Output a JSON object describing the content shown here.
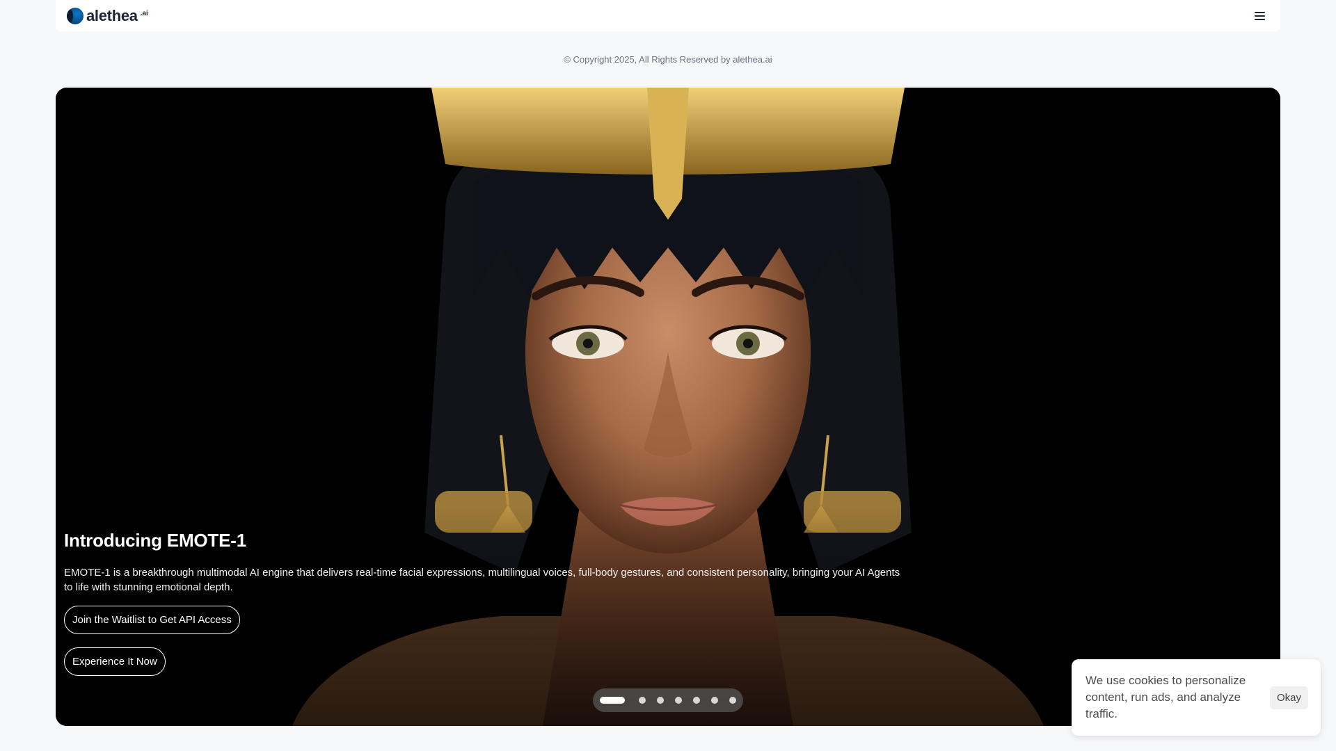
{
  "header": {
    "logo_text": "alethea",
    "logo_suffix": ".ai",
    "menu_icon": "hamburger-menu-icon"
  },
  "footer": {
    "copyright": "© Copyright 2025, All Rights Reserved by alethea.ai"
  },
  "hero": {
    "title": "Introducing EMOTE-1",
    "description": "EMOTE-1 is a breakthrough multimodal AI engine that delivers real-time facial expressions, multilingual voices, full-body gestures, and consistent personality, bringing your AI Agents to life with stunning emotional depth.",
    "primary_button": "Join the Waitlist to Get API Access",
    "secondary_button": "Experience It Now",
    "slides_total": 7,
    "slide_active": 1
  },
  "cookie": {
    "text": "We use cookies to personalize content, run ads, and analyze traffic.",
    "button": "Okay"
  },
  "colors": {
    "page_bg": "#f7f8fa",
    "hero_bg": "#000000",
    "gold": "#c9a24a"
  }
}
